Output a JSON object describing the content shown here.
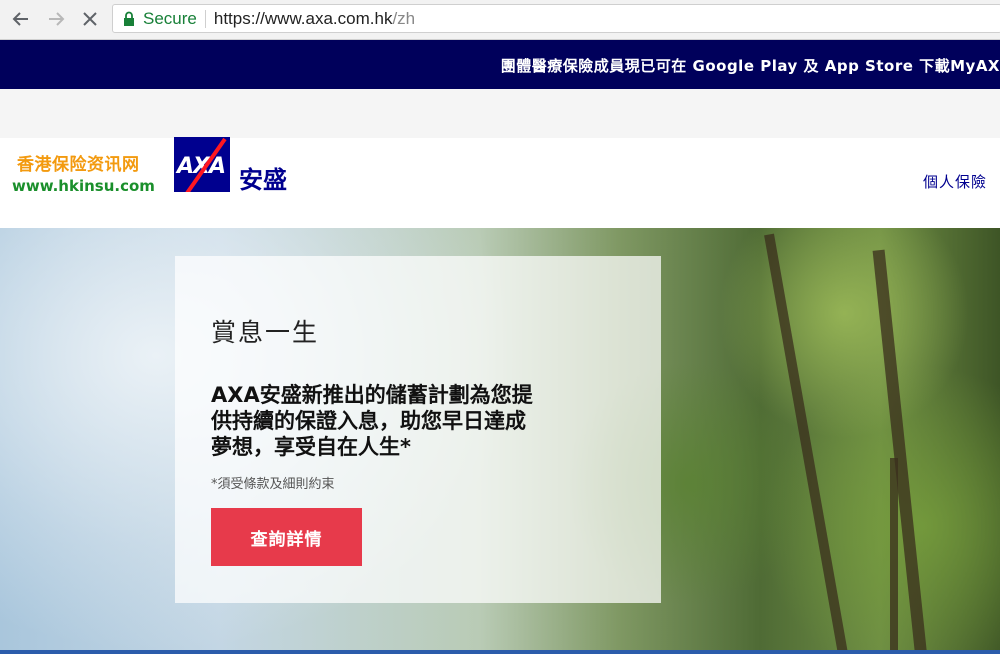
{
  "browser": {
    "secure_label": "Secure",
    "url_host": "https://www.axa.com.hk",
    "url_path": "/zh"
  },
  "announcement": {
    "text": "團體醫療保險成員現已可在 Google Play 及 App Store 下載MyAX"
  },
  "watermark": {
    "chinese": "香港保险资讯网",
    "english": "www.hkinsu.com"
  },
  "header": {
    "logo_text": "AXA",
    "brand_name": "安盛",
    "nav_personal": "個人保險"
  },
  "hero": {
    "title": "賞息一生",
    "lines": [
      "AXA安盛新推出的儲蓄計劃為您提",
      "供持續的保證入息，助您早日達成",
      "夢想，享受自在人生*"
    ],
    "note": "*須受條款及細則約束",
    "cta_label": "查詢詳情"
  },
  "colors": {
    "brand_blue": "#00008f",
    "announce_bg": "#00005b",
    "cta_red": "#e73a4b",
    "secure_green": "#188038"
  }
}
